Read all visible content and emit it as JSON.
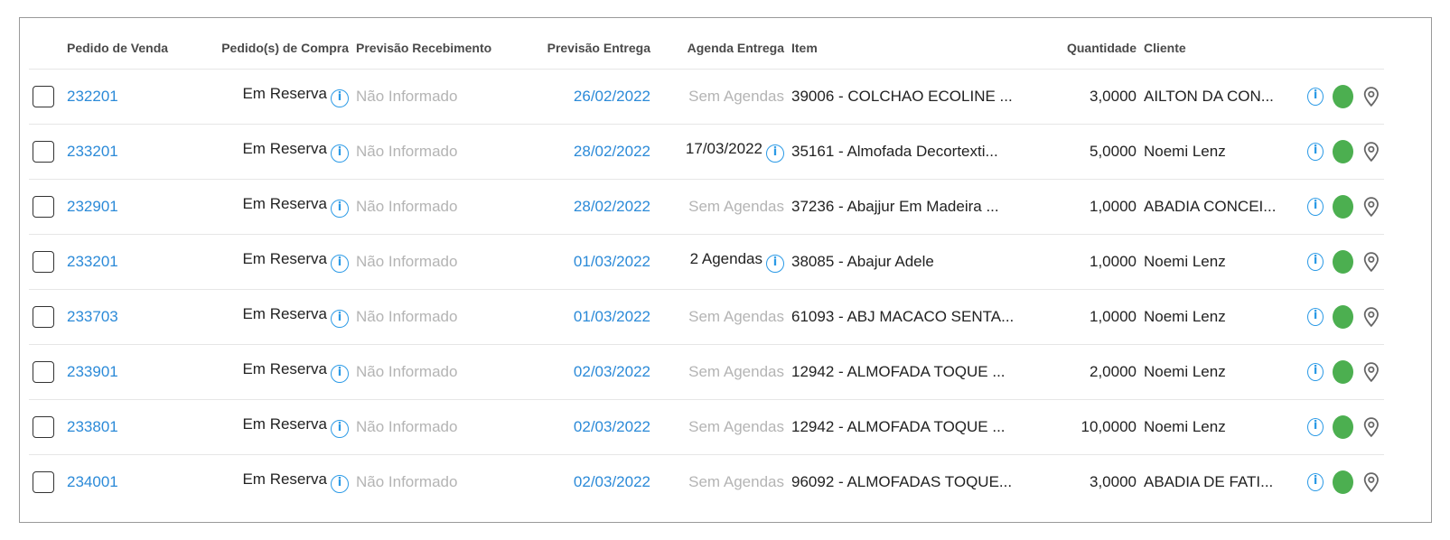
{
  "columns": {
    "pedido_venda": "Pedido de Venda",
    "pedido_compra": "Pedido(s) de Compra",
    "previsao_recebimento": "Previsão Recebimento",
    "previsao_entrega": "Previsão Entrega",
    "agenda_entrega": "Agenda Entrega",
    "item": "Item",
    "quantidade": "Quantidade",
    "cliente": "Cliente"
  },
  "icons": {
    "info": "info-circle-icon",
    "status": "status-dot",
    "location": "map-pin-icon"
  },
  "colors": {
    "link": "#2b8ad8",
    "info": "#2b9ae6",
    "status_ok": "#4caf50",
    "muted": "#b4b4b4"
  },
  "rows": [
    {
      "pedido_venda": "232201",
      "pedido_compra": "Em Reserva",
      "previsao_recebimento": "Não Informado",
      "previsao_entrega": "26/02/2022",
      "agenda_entrega": "Sem Agendas",
      "agenda_info": false,
      "item": "39006 - COLCHAO ECOLINE ...",
      "quantidade": "3,0000",
      "cliente": "AILTON DA CON..."
    },
    {
      "pedido_venda": "233201",
      "pedido_compra": "Em Reserva",
      "previsao_recebimento": "Não Informado",
      "previsao_entrega": "28/02/2022",
      "agenda_entrega": "17/03/2022",
      "agenda_info": true,
      "item": "35161 - Almofada Decortexti...",
      "quantidade": "5,0000",
      "cliente": "Noemi Lenz"
    },
    {
      "pedido_venda": "232901",
      "pedido_compra": "Em Reserva",
      "previsao_recebimento": "Não Informado",
      "previsao_entrega": "28/02/2022",
      "agenda_entrega": "Sem Agendas",
      "agenda_info": false,
      "item": "37236 - Abajjur Em Madeira ...",
      "quantidade": "1,0000",
      "cliente": "ABADIA CONCEI..."
    },
    {
      "pedido_venda": "233201",
      "pedido_compra": "Em Reserva",
      "previsao_recebimento": "Não Informado",
      "previsao_entrega": "01/03/2022",
      "agenda_entrega": "2 Agendas",
      "agenda_info": true,
      "item": "38085 - Abajur Adele",
      "quantidade": "1,0000",
      "cliente": "Noemi Lenz"
    },
    {
      "pedido_venda": "233703",
      "pedido_compra": "Em Reserva",
      "previsao_recebimento": "Não Informado",
      "previsao_entrega": "01/03/2022",
      "agenda_entrega": "Sem Agendas",
      "agenda_info": false,
      "item": "61093 - ABJ MACACO SENTA...",
      "quantidade": "1,0000",
      "cliente": "Noemi Lenz"
    },
    {
      "pedido_venda": "233901",
      "pedido_compra": "Em Reserva",
      "previsao_recebimento": "Não Informado",
      "previsao_entrega": "02/03/2022",
      "agenda_entrega": "Sem Agendas",
      "agenda_info": false,
      "item": "12942 - ALMOFADA TOQUE ...",
      "quantidade": "2,0000",
      "cliente": "Noemi Lenz"
    },
    {
      "pedido_venda": "233801",
      "pedido_compra": "Em Reserva",
      "previsao_recebimento": "Não Informado",
      "previsao_entrega": "02/03/2022",
      "agenda_entrega": "Sem Agendas",
      "agenda_info": false,
      "item": "12942 - ALMOFADA TOQUE ...",
      "quantidade": "10,0000",
      "cliente": "Noemi Lenz"
    },
    {
      "pedido_venda": "234001",
      "pedido_compra": "Em Reserva",
      "previsao_recebimento": "Não Informado",
      "previsao_entrega": "02/03/2022",
      "agenda_entrega": "Sem Agendas",
      "agenda_info": false,
      "item": "96092 - ALMOFADAS TOQUE...",
      "quantidade": "3,0000",
      "cliente": "ABADIA DE FATI..."
    }
  ]
}
